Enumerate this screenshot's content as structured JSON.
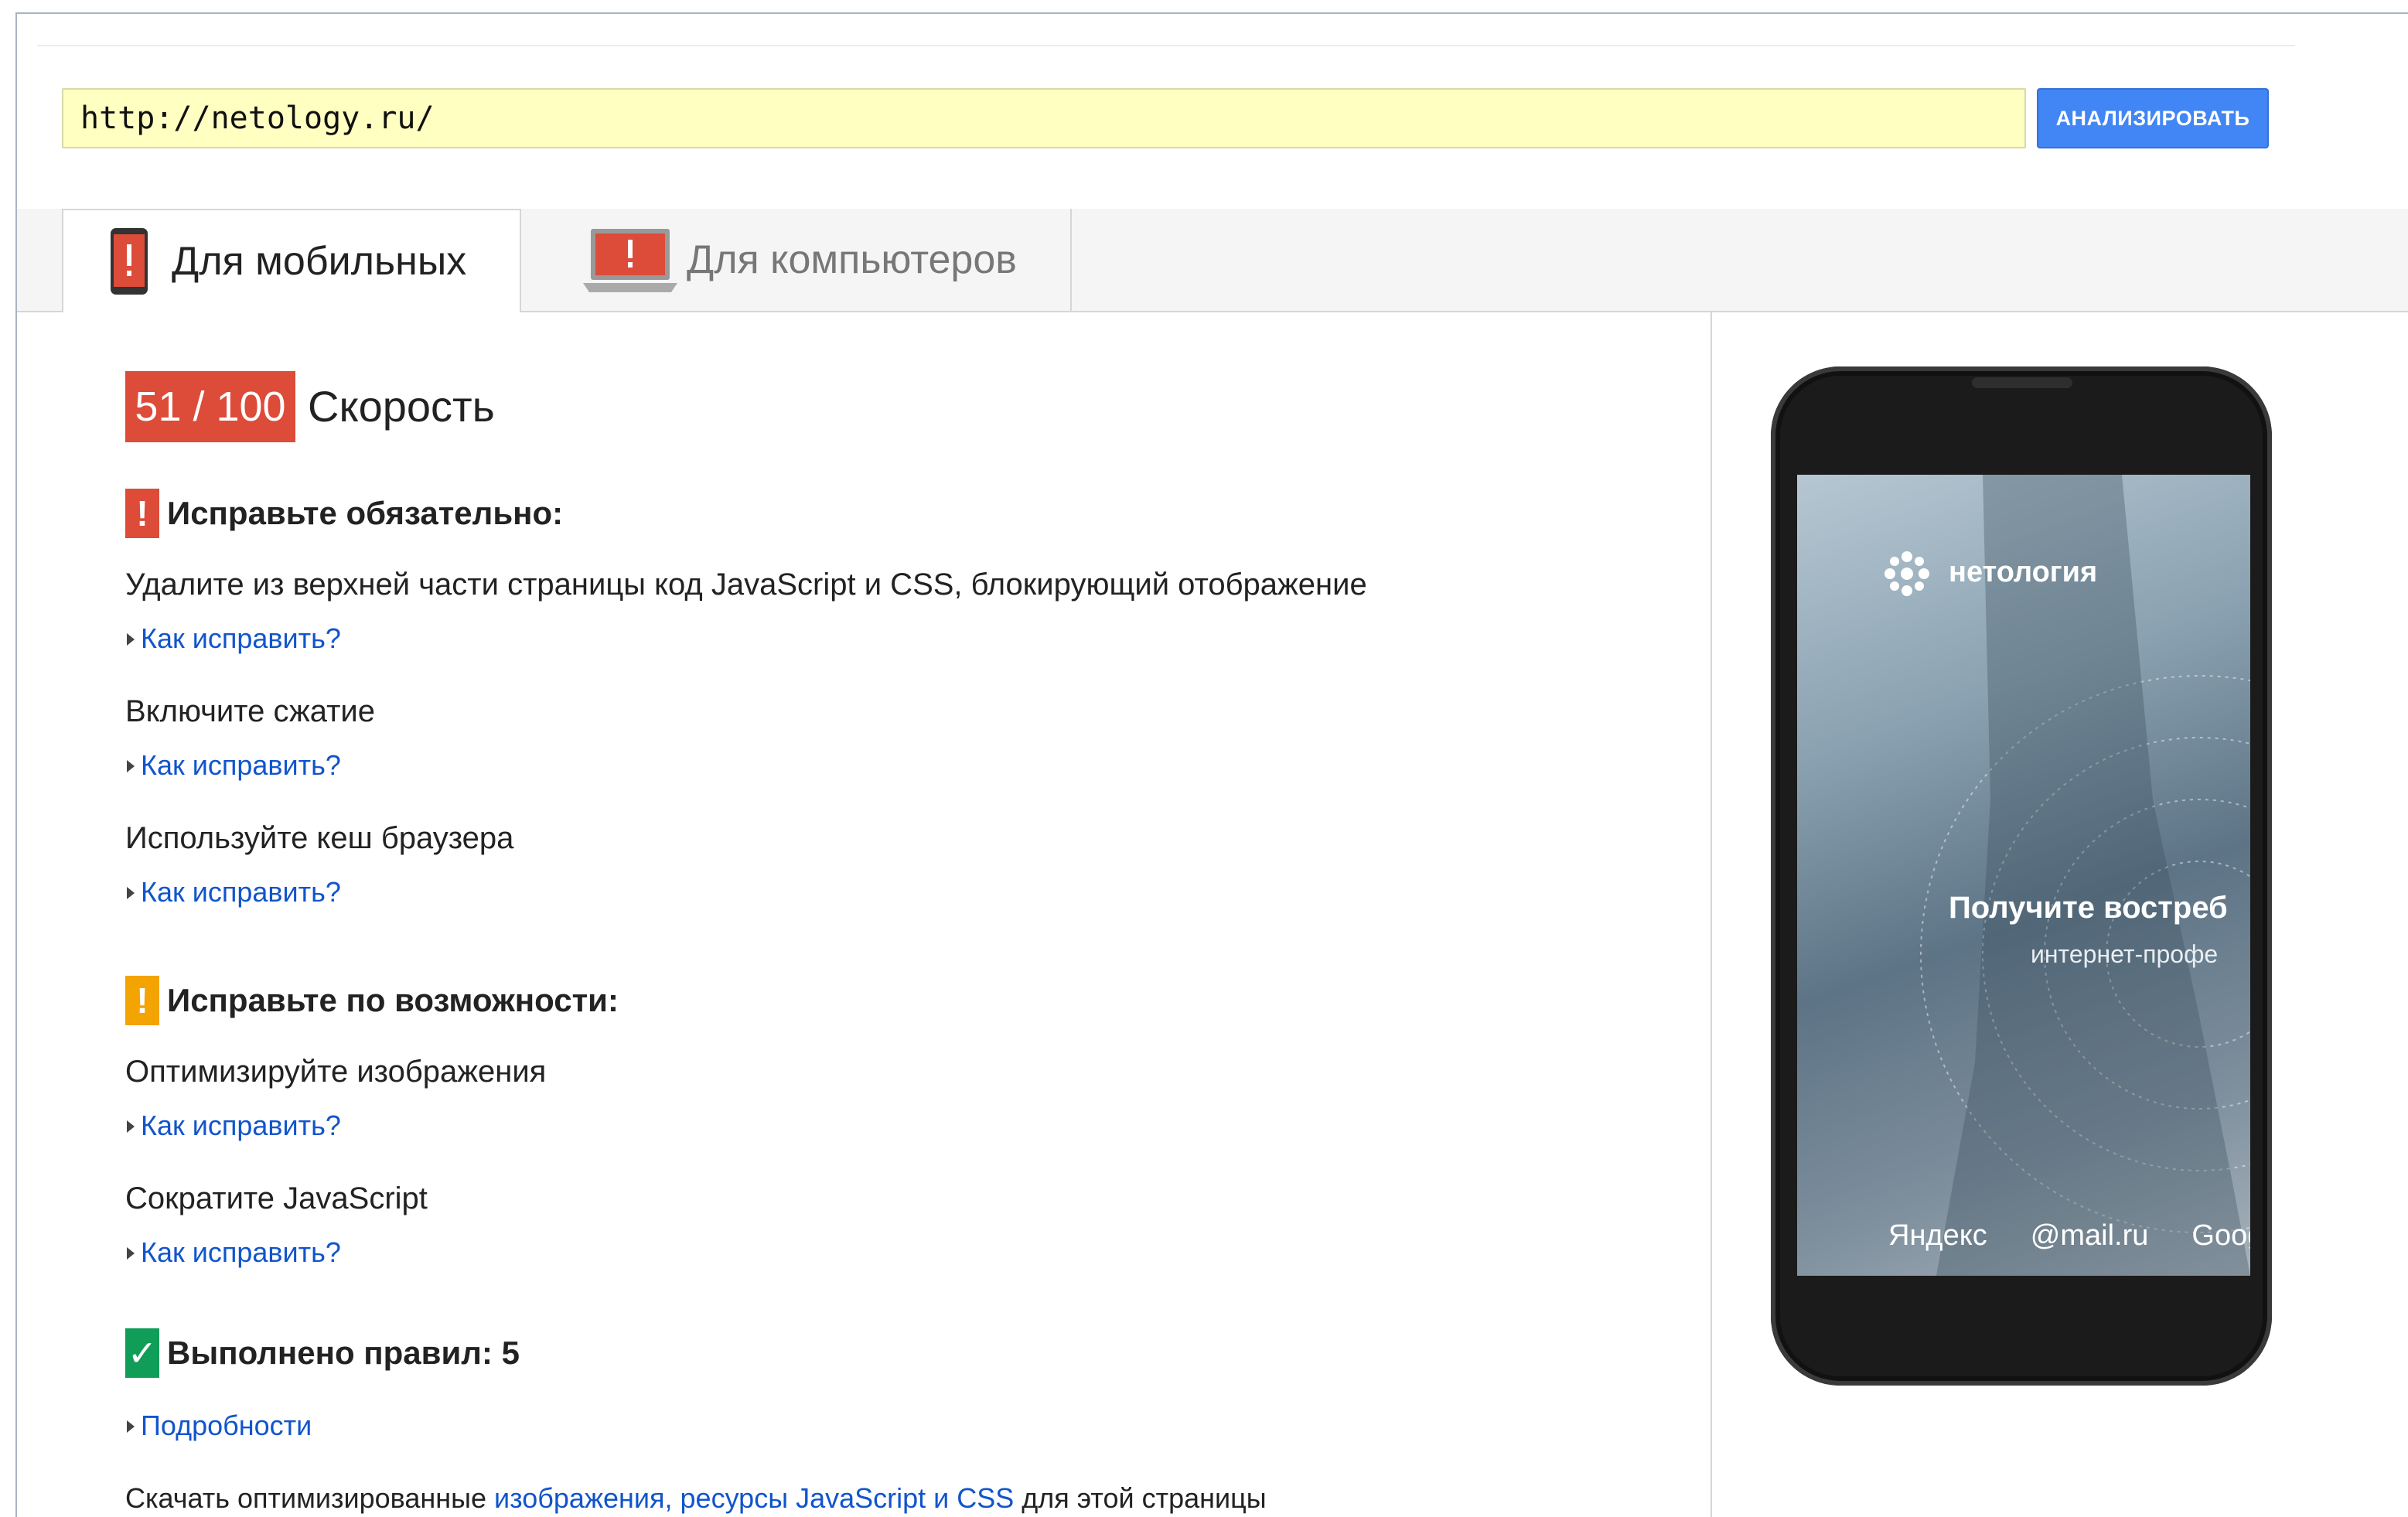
{
  "url_bar": {
    "value": "http://netology.ru/",
    "analyze_label": "АНАЛИЗИРОВАТЬ"
  },
  "tabs": [
    {
      "label": "Для мобильных",
      "icon": "phone-warning-icon",
      "active": true
    },
    {
      "label": "Для компьютеров",
      "icon": "laptop-warning-icon",
      "active": false
    }
  ],
  "score": {
    "value": "51 / 100",
    "label": "Скорость",
    "color": "#dd4b39"
  },
  "sections": {
    "must_fix": {
      "icon": "!",
      "heading": "Исправьте обязательно:",
      "color": "#dd4b39",
      "rules": [
        {
          "title": "Удалите из верхней части страницы код JavaScript и CSS, блокирующий отображение",
          "link": "Как исправить?"
        },
        {
          "title": "Включите сжатие",
          "link": "Как исправить?"
        },
        {
          "title": "Используйте кеш браузера",
          "link": "Как исправить?"
        }
      ]
    },
    "should_fix": {
      "icon": "!",
      "heading": "Исправьте по возможности:",
      "color": "#f4a400",
      "rules": [
        {
          "title": "Оптимизируйте изображения",
          "link": "Как исправить?"
        },
        {
          "title": "Сократите JavaScript",
          "link": "Как исправить?"
        }
      ]
    },
    "passed": {
      "icon": "✓",
      "heading": "Выполнено правил: 5",
      "color": "#0f9d58",
      "link": "Подробности"
    }
  },
  "footer": {
    "prefix": "Скачать оптимизированные ",
    "link": "изображения, ресурсы JavaScript и CSS",
    "suffix": " для этой страницы"
  },
  "preview": {
    "logo_text": "нетология",
    "headline": "Получите востреб",
    "subline": "интернет-профе",
    "partners": [
      "Яндекс",
      "@mail.ru",
      "Goog"
    ]
  }
}
